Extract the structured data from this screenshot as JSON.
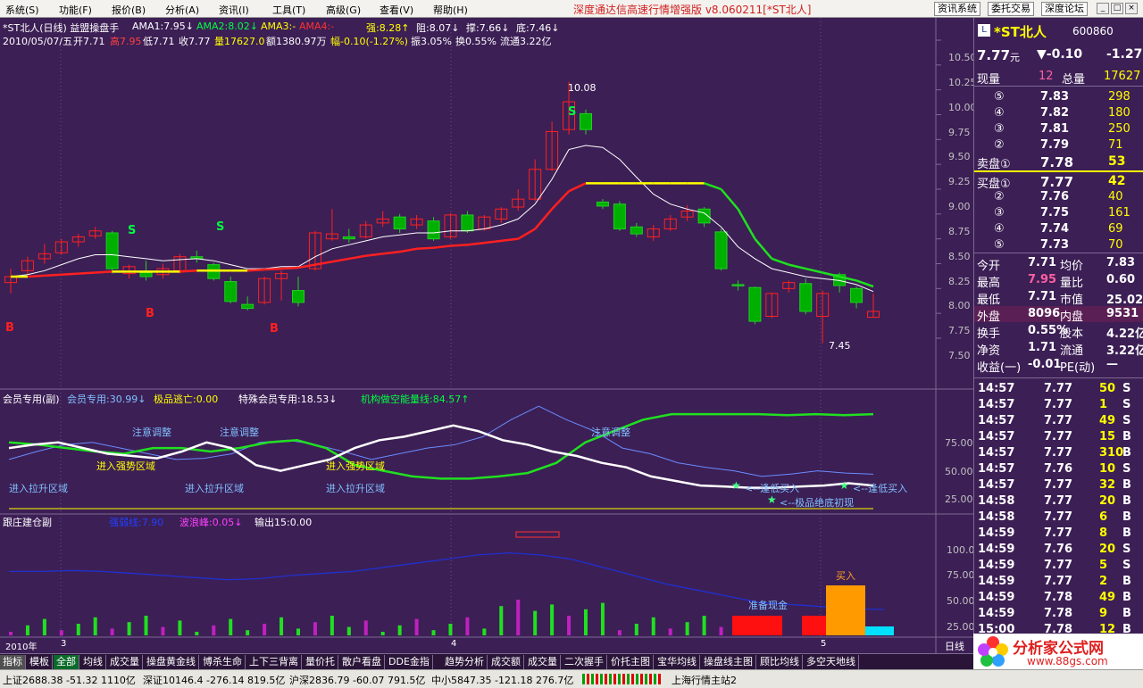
{
  "menubar": {
    "menus": [
      "系统(S)",
      "功能(F)",
      "报价(B)",
      "分析(A)",
      "资讯(I)",
      "工具(T)",
      "高级(G)",
      "查看(V)",
      "帮助(H)"
    ],
    "title": "深度通达信高速行情增强版  v8.060211[*ST北人]",
    "buttons": [
      "资讯系统",
      "委托交易",
      "深度论坛"
    ]
  },
  "header": {
    "line1_prefix": "*ST北人(日线) 益盟操盘手",
    "ama1": "AMA1:7.95↓",
    "ama2": "AMA2:8.02↓",
    "ama3": "AMA3:-",
    "ama4": "AMA4:-",
    "strong": "强:8.28↑",
    "resist": "阻:8.07↓",
    "support": "撑:7.66↓",
    "bottom": "底:7.46↓",
    "line2_date": "2010/05/07/五",
    "open": "开7.71",
    "high": "高7.95",
    "low": "低7.71",
    "close": "收7.77",
    "vol": "量17627.0",
    "amt": "额1380.97万",
    "chg": "幅-0.10(-1.27%)",
    "amp": "振3.05%",
    "turn": "换0.55%",
    "float": "流通3.22亿"
  },
  "price_axis": [
    "10.50",
    "10.25",
    "10.00",
    "9.75",
    "9.50",
    "9.25",
    "9.00",
    "8.75",
    "8.50",
    "8.25",
    "8.00",
    "7.75",
    "7.50"
  ],
  "price_annotations": {
    "high": "10.08",
    "low": "7.45"
  },
  "signals": {
    "s": "S",
    "b": "B"
  },
  "indicator1": {
    "title": "会员专用(副)",
    "member": "会员专用:30.99↓",
    "escape": "极品逃亡:0.00",
    "special": "特殊会员专用:18.53↓",
    "inst": "机构做空能量线:84.57↑",
    "labels": {
      "attention": "注意调整",
      "strong_zone": "进入强势区域",
      "rally_zone": "进入拉升区域",
      "buy_low": "<--逢低买入",
      "bottom_first": "<--极品绝底初现"
    },
    "axis": [
      "75.00",
      "50.00",
      "25.00"
    ]
  },
  "indicator2": {
    "title": "跟庄建仓副",
    "item1": "强弱线:7.90",
    "item2": "波浪峰:0.05↓",
    "item3": "输出15:0.00",
    "labels": {
      "buy": "买入",
      "cash": "准备现金"
    },
    "axis": [
      "100.0",
      "75.00",
      "50.00",
      "25.00"
    ]
  },
  "time_axis": [
    "2010年",
    "3",
    "4",
    "5"
  ],
  "period": "日线",
  "quote": {
    "name": "*ST北人",
    "code": "600860",
    "price": "7.77",
    "unit": "元",
    "change": "▼-0.10",
    "pct": "-1.27",
    "now_vol_label": "现量",
    "now_vol": "12",
    "total_vol_label": "总量",
    "total_vol": "17627",
    "asks": [
      [
        "⑤",
        "7.83",
        "298"
      ],
      [
        "④",
        "7.82",
        "180"
      ],
      [
        "③",
        "7.81",
        "250"
      ],
      [
        "②",
        "7.79",
        "71"
      ],
      [
        "卖盘①",
        "7.78",
        "53"
      ]
    ],
    "bids": [
      [
        "买盘①",
        "7.77",
        "42"
      ],
      [
        "②",
        "7.76",
        "40"
      ],
      [
        "③",
        "7.75",
        "161"
      ],
      [
        "④",
        "7.74",
        "69"
      ],
      [
        "⑤",
        "7.73",
        "70"
      ]
    ],
    "stats": [
      [
        "今开",
        "7.71",
        "均价",
        "7.83"
      ],
      [
        "最高",
        "7.95",
        "量比",
        "0.60"
      ],
      [
        "最低",
        "7.71",
        "市值",
        "25.02亿"
      ],
      [
        "外盘",
        "8096",
        "内盘",
        "9531"
      ],
      [
        "换手",
        "0.55%",
        "股本",
        "4.22亿"
      ],
      [
        "净资",
        "1.71",
        "流通",
        "3.22亿"
      ],
      [
        "收益(一)",
        "-0.01",
        "PE(动)",
        "—"
      ]
    ]
  },
  "ticks": [
    [
      "14:57",
      "7.77",
      "50",
      "S"
    ],
    [
      "14:57",
      "7.77",
      "1",
      "S"
    ],
    [
      "14:57",
      "7.77",
      "49",
      "S"
    ],
    [
      "14:57",
      "7.77",
      "15",
      "B"
    ],
    [
      "14:57",
      "7.77",
      "310",
      "B"
    ],
    [
      "14:57",
      "7.76",
      "10",
      "S"
    ],
    [
      "14:57",
      "7.77",
      "32",
      "B"
    ],
    [
      "14:58",
      "7.77",
      "20",
      "B"
    ],
    [
      "14:58",
      "7.77",
      "6",
      "B"
    ],
    [
      "14:59",
      "7.77",
      "8",
      "B"
    ],
    [
      "14:59",
      "7.76",
      "20",
      "S"
    ],
    [
      "14:59",
      "7.77",
      "5",
      "S"
    ],
    [
      "14:59",
      "7.77",
      "2",
      "B"
    ],
    [
      "14:59",
      "7.78",
      "49",
      "B"
    ],
    [
      "14:59",
      "7.78",
      "9",
      "B"
    ],
    [
      "15:00",
      "7.78",
      "12",
      "B"
    ]
  ],
  "tabs": [
    "指标",
    "模板",
    "全部",
    "均线",
    "成交量",
    "操盘黄金线",
    "博杀生命",
    "上下三背离",
    "量价托",
    "散户看盘",
    "DDE金指",
    "趋势分析",
    "成交额",
    "成交量",
    "二次握手",
    "价托主图",
    "宝华均线",
    "操盘线主图",
    "顾比均线",
    "多空天地线"
  ],
  "status": {
    "sh": "上证2688.38 -51.32 1110亿",
    "sz": "深证10146.4 -276.14 819.5亿",
    "hs": "沪深2836.79 -60.07 791.5亿",
    "zx": "中小5847.35 -121.18 276.7亿",
    "station": "上海行情主站2"
  },
  "logo": {
    "main": "分析家公式网",
    "url": "www.88gs.com"
  },
  "colors": {
    "bg": "#3c1f55",
    "up": "#e00000",
    "down": "#00c000",
    "price_yellow": "#ffff00",
    "label_cyan": "#80c0ff"
  },
  "chart_data": {
    "type": "candlestick",
    "candles": [
      [
        8.06,
        8.12,
        7.95,
        8.2
      ],
      [
        8.18,
        8.28,
        8.14,
        8.32
      ],
      [
        8.3,
        8.35,
        8.25,
        8.45
      ],
      [
        8.36,
        8.47,
        8.34,
        8.5
      ],
      [
        8.47,
        8.52,
        8.42,
        8.55
      ],
      [
        8.53,
        8.58,
        8.5,
        8.62
      ],
      [
        8.56,
        8.2,
        8.15,
        8.58
      ],
      [
        8.15,
        8.22,
        8.1,
        8.24
      ],
      [
        8.16,
        8.12,
        8.08,
        8.28
      ],
      [
        8.14,
        8.2,
        8.1,
        8.25
      ],
      [
        8.18,
        8.32,
        8.15,
        8.35
      ],
      [
        8.32,
        8.3,
        8.26,
        8.38
      ],
      [
        8.24,
        8.1,
        8.08,
        8.26
      ],
      [
        8.07,
        7.87,
        7.85,
        8.12
      ],
      [
        7.84,
        7.8,
        7.78,
        7.92
      ],
      [
        7.86,
        8.1,
        7.84,
        8.12
      ],
      [
        8.1,
        8.15,
        7.88,
        8.18
      ],
      [
        7.98,
        7.86,
        7.82,
        8.12
      ],
      [
        8.2,
        8.56,
        8.18,
        8.58
      ],
      [
        8.5,
        8.55,
        8.48,
        8.8
      ],
      [
        8.52,
        8.5,
        8.46,
        8.6
      ],
      [
        8.52,
        8.64,
        8.5,
        8.68
      ],
      [
        8.66,
        8.7,
        8.62,
        8.78
      ],
      [
        8.72,
        8.6,
        8.56,
        8.75
      ],
      [
        8.64,
        8.7,
        8.6,
        8.74
      ],
      [
        8.68,
        8.5,
        8.48,
        8.72
      ],
      [
        8.52,
        8.74,
        8.5,
        8.76
      ],
      [
        8.74,
        8.58,
        8.56,
        8.78
      ],
      [
        8.6,
        8.72,
        8.58,
        8.74
      ],
      [
        8.7,
        8.8,
        8.66,
        8.82
      ],
      [
        8.82,
        8.9,
        8.78,
        9.0
      ],
      [
        8.9,
        9.2,
        8.88,
        9.3
      ],
      [
        9.2,
        9.58,
        9.18,
        9.68
      ],
      [
        9.6,
        9.88,
        9.55,
        10.08
      ],
      [
        9.76,
        9.6,
        9.55,
        9.8
      ],
      [
        8.87,
        8.83,
        8.8,
        8.9
      ],
      [
        8.85,
        8.6,
        8.58,
        8.88
      ],
      [
        8.62,
        8.55,
        8.52,
        8.66
      ],
      [
        8.52,
        8.6,
        8.48,
        8.64
      ],
      [
        8.6,
        8.7,
        8.58,
        8.74
      ],
      [
        8.72,
        8.78,
        8.68,
        8.84
      ],
      [
        8.8,
        8.66,
        8.62,
        8.82
      ],
      [
        8.57,
        8.2,
        8.18,
        8.6
      ],
      [
        8.04,
        8.03,
        7.98,
        8.08
      ],
      [
        8.01,
        7.67,
        7.64,
        8.02
      ],
      [
        7.72,
        7.95,
        7.7,
        7.96
      ],
      [
        8.0,
        8.06,
        7.96,
        8.08
      ],
      [
        8.05,
        7.77,
        7.74,
        8.1
      ],
      [
        7.72,
        7.95,
        7.45,
        7.98
      ],
      [
        8.14,
        8.03,
        7.96,
        8.16
      ],
      [
        8.0,
        7.86,
        7.8,
        8.02
      ],
      [
        7.71,
        7.77,
        7.71,
        7.95
      ]
    ],
    "ama1": [
      8.12,
      8.14,
      8.18,
      8.24,
      8.3,
      8.34,
      8.34,
      8.32,
      8.3,
      8.28,
      8.29,
      8.3,
      8.28,
      8.24,
      8.2,
      8.2,
      8.22,
      8.22,
      8.32,
      8.4,
      8.44,
      8.48,
      8.52,
      8.54,
      8.56,
      8.56,
      8.58,
      8.58,
      8.6,
      8.64,
      8.7,
      8.85,
      9.1,
      9.4,
      9.44,
      9.42,
      9.3,
      9.12,
      8.95,
      8.85,
      8.8,
      8.76,
      8.62,
      8.42,
      8.3,
      8.2,
      8.16,
      8.12,
      8.1,
      8.08,
      8.04,
      7.97
    ],
    "ama2": [
      8.12,
      8.12,
      8.13,
      8.14,
      8.15,
      8.16,
      8.17,
      8.17,
      8.17,
      8.17,
      8.17,
      8.18,
      8.18,
      8.18,
      8.18,
      8.19,
      8.2,
      8.21,
      8.24,
      8.27,
      8.3,
      8.33,
      8.35,
      8.37,
      8.4,
      8.41,
      8.43,
      8.44,
      8.46,
      8.48,
      8.5,
      8.6,
      8.8,
      8.98,
      9.06,
      9.06,
      9.06,
      9.06,
      9.06,
      9.06,
      9.06,
      9.06,
      9.0,
      8.8,
      8.5,
      8.3,
      8.24,
      8.2,
      8.16,
      8.12,
      8.08,
      8.02
    ],
    "indicator1_series": {
      "member_white": [
        55,
        58,
        60,
        55,
        50,
        48,
        46,
        52,
        60,
        55,
        40,
        35,
        40,
        45,
        55,
        62,
        65,
        70,
        75,
        70,
        62,
        58,
        52,
        48,
        42,
        38,
        30,
        26,
        22,
        21,
        20,
        20,
        21,
        22,
        24,
        22
      ],
      "inst_green": [
        60,
        58,
        55,
        52,
        50,
        55,
        55,
        52,
        55,
        60,
        62,
        55,
        40,
        35,
        30,
        28,
        28,
        30,
        33,
        42,
        60,
        70,
        80,
        85,
        85,
        85,
        85,
        84,
        85,
        84,
        85
      ],
      "member_blue": [
        45,
        52,
        58,
        60,
        55,
        50,
        45,
        46,
        50,
        60,
        62,
        58,
        52,
        45,
        50,
        55,
        58,
        65,
        80,
        92,
        80,
        70,
        55,
        50,
        42,
        38,
        35,
        30,
        32,
        35,
        33,
        32
      ]
    },
    "indicator2_series": {
      "strength_blue": [
        62,
        62,
        63,
        62,
        60,
        58,
        56,
        54,
        55,
        58,
        60,
        62,
        66,
        70,
        74,
        78,
        80,
        78,
        74,
        66,
        58,
        50,
        44,
        38,
        32,
        30,
        28,
        26,
        25
      ]
    }
  }
}
